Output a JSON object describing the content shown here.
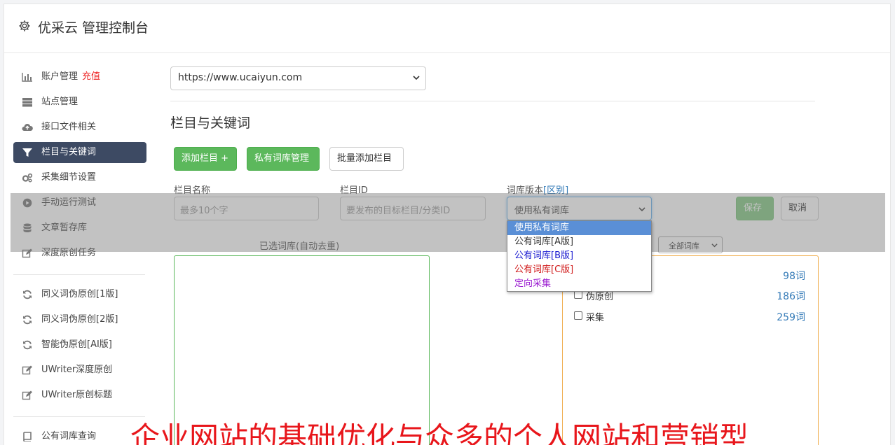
{
  "header": {
    "title": "优采云 管理控制台",
    "icon": "gear-icon"
  },
  "sidebar": {
    "group1": [
      {
        "label": "账户管理",
        "badge": "充值",
        "icon": "bar-chart-icon"
      },
      {
        "label": "站点管理",
        "icon": "server-icon"
      },
      {
        "label": "接口文件相关",
        "icon": "cloud-upload-icon"
      },
      {
        "label": "栏目与关键词",
        "icon": "filter-icon",
        "active": true
      },
      {
        "label": "采集细节设置",
        "icon": "cogs-icon"
      },
      {
        "label": "手动运行测试",
        "icon": "play-circle-icon"
      },
      {
        "label": "文章暂存库",
        "icon": "database-icon"
      },
      {
        "label": "深度原创任务",
        "icon": "edit-icon"
      }
    ],
    "group2": [
      {
        "label": "同义词伪原创[1版]",
        "icon": "refresh-icon"
      },
      {
        "label": "同义词伪原创[2版]",
        "icon": "refresh-icon"
      },
      {
        "label": "智能伪原创[AI版]",
        "icon": "refresh-icon"
      },
      {
        "label": "UWriter深度原创",
        "icon": "edit-icon"
      },
      {
        "label": "UWriter原创标题",
        "icon": "edit-icon"
      }
    ],
    "group3": [
      {
        "label": "公有词库查询",
        "icon": "book-icon"
      }
    ]
  },
  "main": {
    "site_select": "https://www.ucaiyun.com",
    "section_title": "栏目与关键词",
    "buttons": {
      "add_column": "添加栏目 +",
      "private_lib": "私有词库管理",
      "batch_add": "批量添加栏目"
    },
    "form": {
      "name_label": "栏目名称",
      "name_placeholder": "最多10个字",
      "id_label": "栏目ID",
      "id_placeholder": "要发布的目标栏目/分类ID",
      "version_label": "词库版本",
      "version_link": "[区别]",
      "version_value": "使用私有词库",
      "save": "保存",
      "cancel": "取消"
    },
    "dropdown_options": [
      {
        "label": "使用私有词库",
        "color": "#ffffff",
        "selected": true
      },
      {
        "label": "公有词库[A版]",
        "color": "#333333"
      },
      {
        "label": "公有词库[B版]",
        "color": "#1a1ad0"
      },
      {
        "label": "公有词库[C版]",
        "color": "#d01a1a"
      },
      {
        "label": "定向采集",
        "color": "#9a1ad0"
      }
    ],
    "selected_label": "已选词库(自动去重)",
    "filter_select": "全部词库",
    "libraries": [
      {
        "name": "",
        "count": "98词"
      },
      {
        "name": "伪原创",
        "count": "186词"
      },
      {
        "name": "采集",
        "count": "259词"
      }
    ]
  },
  "caption": "企业网站的基础优化与众多的个人网站和营销型"
}
